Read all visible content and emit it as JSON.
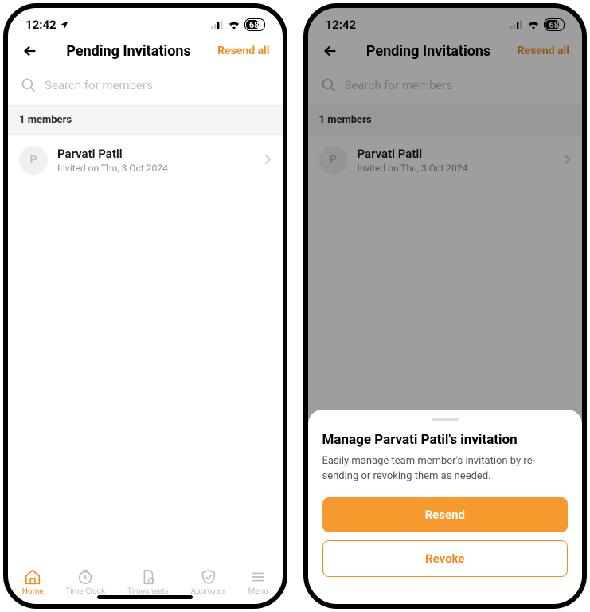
{
  "status": {
    "time": "12:42",
    "battery": "68"
  },
  "header": {
    "title": "Pending Invitations",
    "action": "Resend all"
  },
  "search": {
    "placeholder": "Search for members"
  },
  "section": {
    "count_label": "1 members"
  },
  "member": {
    "initial": "P",
    "name": "Parvati Patil",
    "sub": "Invited on Thu, 3 Oct 2024"
  },
  "tabs": {
    "home": "Home",
    "timeclock": "Time Clock",
    "timesheets": "Timesheets",
    "approvals": "Approvals",
    "menu": "Menu"
  },
  "sheet": {
    "title": "Manage Parvati Patil's invitation",
    "desc": "Easily manage team member's invitation by re-sending or revoking them as needed.",
    "resend": "Resend",
    "revoke": "Revoke"
  },
  "colors": {
    "accent": "#f28c1e"
  }
}
